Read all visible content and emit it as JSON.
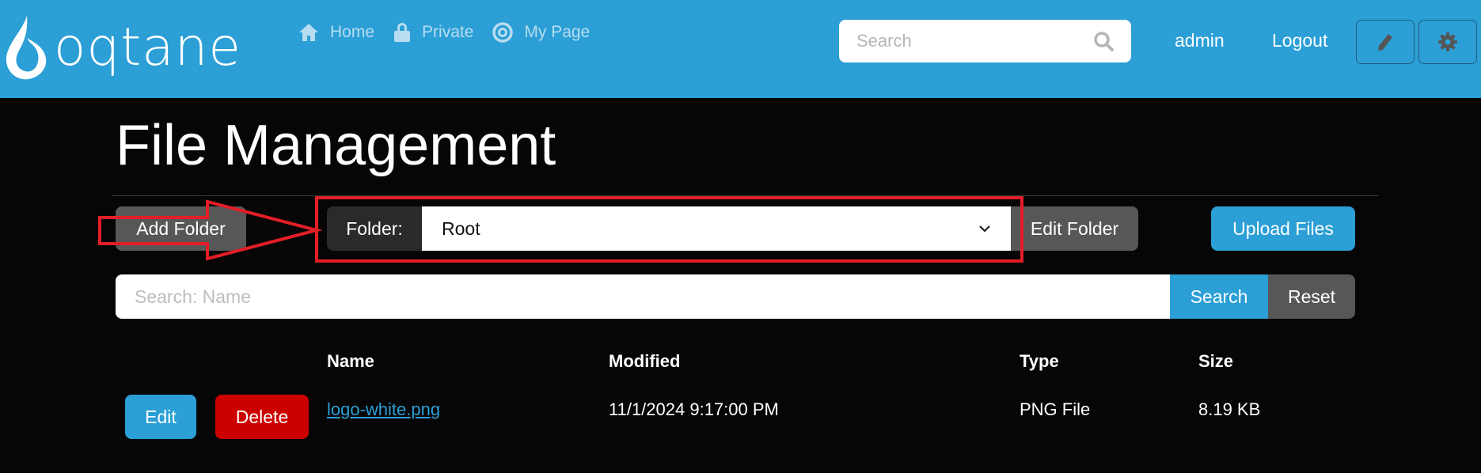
{
  "navbar": {
    "brand": "oqtane",
    "links": [
      {
        "label": "Home",
        "icon": "home-icon"
      },
      {
        "label": "Private",
        "icon": "lock-icon"
      },
      {
        "label": "My Page",
        "icon": "target-icon"
      }
    ],
    "search_placeholder": "Search",
    "user": "admin",
    "logout": "Logout",
    "edit_icon": "pencil-icon",
    "settings_icon": "gear-icon"
  },
  "page": {
    "title": "File Management"
  },
  "toolbar": {
    "add_folder": "Add Folder",
    "folder_label": "Folder:",
    "folder_value": "Root",
    "edit_folder": "Edit Folder",
    "upload_files": "Upload Files"
  },
  "filter": {
    "placeholder": "Search: Name",
    "search": "Search",
    "reset": "Reset"
  },
  "table": {
    "headers": [
      "Name",
      "Modified",
      "Type",
      "Size"
    ],
    "rows": [
      {
        "edit": "Edit",
        "delete": "Delete",
        "name": "logo-white.png",
        "modified": "11/1/2024 9:17:00 PM",
        "type": "PNG File",
        "size": "8.19 KB"
      }
    ]
  },
  "colors": {
    "primary": "#2b9fd6",
    "danger": "#cc0000",
    "secondary": "#575757",
    "annotation": "#e41e26"
  }
}
